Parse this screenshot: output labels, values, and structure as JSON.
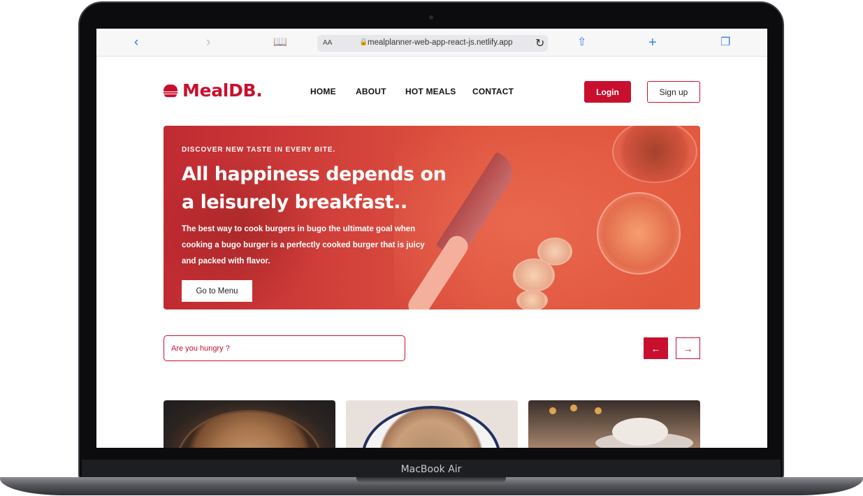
{
  "device": {
    "label": "MacBook Air"
  },
  "browser": {
    "url": "mealplanner-web-app-react-js.netlify.app",
    "text_size_label": "AA"
  },
  "nav": {
    "logo": "MealDB.",
    "links": [
      "HOME",
      "ABOUT",
      "HOT MEALS",
      "CONTACT"
    ],
    "login": "Login",
    "signup": "Sign up"
  },
  "hero": {
    "kicker": "DISCOVER NEW TASTE IN EVERY BITE.",
    "title": "All happiness depends on a leisurely breakfast..",
    "description": "The best way to cook burgers in bugo the ultimate goal when cooking a bugo burger is a perfectly cooked burger that is juicy and packed with flavor.",
    "button": "Go to Menu"
  },
  "search": {
    "placeholder": "Are you hungry ?"
  },
  "carousel": {
    "prev_icon": "←",
    "next_icon": "→"
  },
  "colors": {
    "brand": "#c8102e"
  }
}
